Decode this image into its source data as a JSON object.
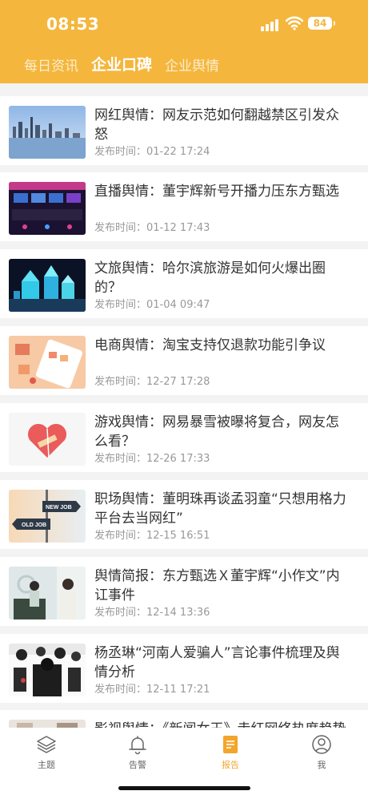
{
  "status": {
    "time": "08:53",
    "battery": "84"
  },
  "tabs": [
    {
      "label": "每日资讯",
      "active": false
    },
    {
      "label": "企业口碑",
      "active": true
    },
    {
      "label": "企业舆情",
      "active": false
    }
  ],
  "articles": [
    {
      "title": "网红舆情：网友示范如何翻越禁区引发众怒",
      "time_label": "发布时间：",
      "time": "01-22 17:24"
    },
    {
      "title": "直播舆情：董宇辉新号开播力压东方甄选",
      "time_label": "发布时间：",
      "time": "01-12 17:43"
    },
    {
      "title": "文旅舆情：哈尔滨旅游是如何火爆出圈的？",
      "time_label": "发布时间：",
      "time": "01-04 09:47"
    },
    {
      "title": "电商舆情：淘宝支持仅退款功能引争议",
      "time_label": "发布时间：",
      "time": "12-27 17:28"
    },
    {
      "title": "游戏舆情：网易暴雪被曝将复合，网友怎么看？",
      "time_label": "发布时间：",
      "time": "12-26 17:33"
    },
    {
      "title": "职场舆情：董明珠再谈孟羽童“只想用格力平台去当网红”",
      "time_label": "发布时间：",
      "time": "12-15 16:51"
    },
    {
      "title": "舆情简报：东方甄选Ｘ董宇辉“小作文”内讧事件",
      "time_label": "发布时间：",
      "time": "12-14 13:36"
    },
    {
      "title": "杨丞琳“河南人爱骗人”言论事件梳理及舆情分析",
      "time_label": "发布时间：",
      "time": "12-11 17:21"
    },
    {
      "title": "影视舆情：《新闻女王》走红网络热度趋势",
      "time_label": "",
      "time": ""
    }
  ],
  "thumb_texts": {
    "new_job": "NEW JOB",
    "old_job": "OLD JOB"
  },
  "tabbar": [
    {
      "label": "主题",
      "icon": "layers-icon",
      "active": false
    },
    {
      "label": "告警",
      "icon": "bell-icon",
      "active": false
    },
    {
      "label": "报告",
      "icon": "report-icon",
      "active": true
    },
    {
      "label": "我",
      "icon": "user-icon",
      "active": false
    }
  ],
  "colors": {
    "brand": "#f4b63c",
    "active_tab": "#f4a52c",
    "title": "#333333",
    "meta": "#999999"
  }
}
